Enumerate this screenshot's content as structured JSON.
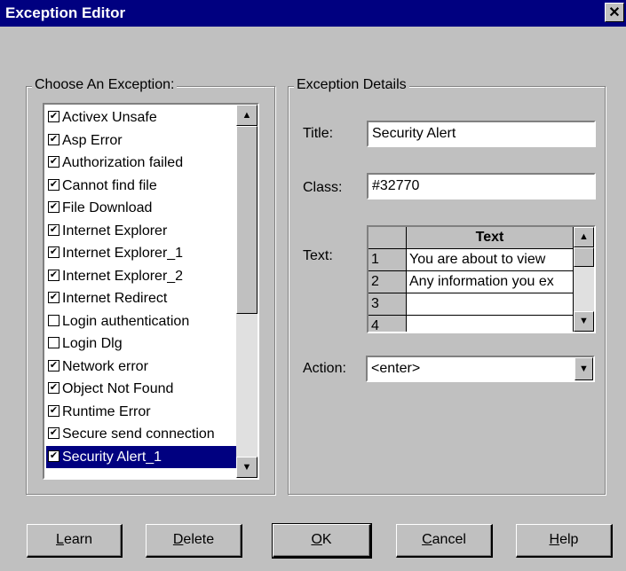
{
  "window": {
    "title": "Exception Editor",
    "close_glyph": "✕"
  },
  "choose_group": {
    "legend": "Choose An Exception:",
    "items": [
      {
        "label": "Activex Unsafe",
        "checked": true
      },
      {
        "label": "Asp Error",
        "checked": true
      },
      {
        "label": "Authorization failed",
        "checked": true
      },
      {
        "label": "Cannot find file",
        "checked": true
      },
      {
        "label": "File Download",
        "checked": true
      },
      {
        "label": "Internet Explorer",
        "checked": true
      },
      {
        "label": "Internet Explorer_1",
        "checked": true
      },
      {
        "label": "Internet Explorer_2",
        "checked": true
      },
      {
        "label": "Internet Redirect",
        "checked": true
      },
      {
        "label": "Login authentication",
        "checked": false
      },
      {
        "label": "Login Dlg",
        "checked": false
      },
      {
        "label": "Network error",
        "checked": true
      },
      {
        "label": "Object Not Found",
        "checked": true
      },
      {
        "label": "Runtime Error",
        "checked": true
      },
      {
        "label": "Secure send connection",
        "checked": true
      },
      {
        "label": "Security Alert_1",
        "checked": true,
        "selected": true
      }
    ]
  },
  "details_group": {
    "legend": "Exception Details",
    "title_label": "Title:",
    "title_value": "Security Alert",
    "class_label": "Class:",
    "class_value": "#32770",
    "text_label": "Text:",
    "text_grid": {
      "column_header": "Text",
      "rows": [
        {
          "num": "1",
          "value": "You are about to view"
        },
        {
          "num": "2",
          "value": "Any information you ex"
        },
        {
          "num": "3",
          "value": ""
        },
        {
          "num": "4",
          "value": ""
        }
      ]
    },
    "action_label": "Action:",
    "action_value": "<enter>"
  },
  "buttons": {
    "learn": {
      "mnemonic": "L",
      "rest": "earn"
    },
    "delete": {
      "mnemonic": "D",
      "rest": "elete"
    },
    "ok": {
      "mnemonic": "O",
      "rest": "K"
    },
    "cancel": {
      "mnemonic": "C",
      "rest": "ancel"
    },
    "help": {
      "mnemonic": "H",
      "rest": "elp"
    }
  },
  "icons": {
    "check": "✔",
    "arrow_up": "▲",
    "arrow_down": "▼"
  },
  "colors": {
    "titlebar": "#000080",
    "selection": "#000080",
    "face": "#c0c0c0"
  }
}
